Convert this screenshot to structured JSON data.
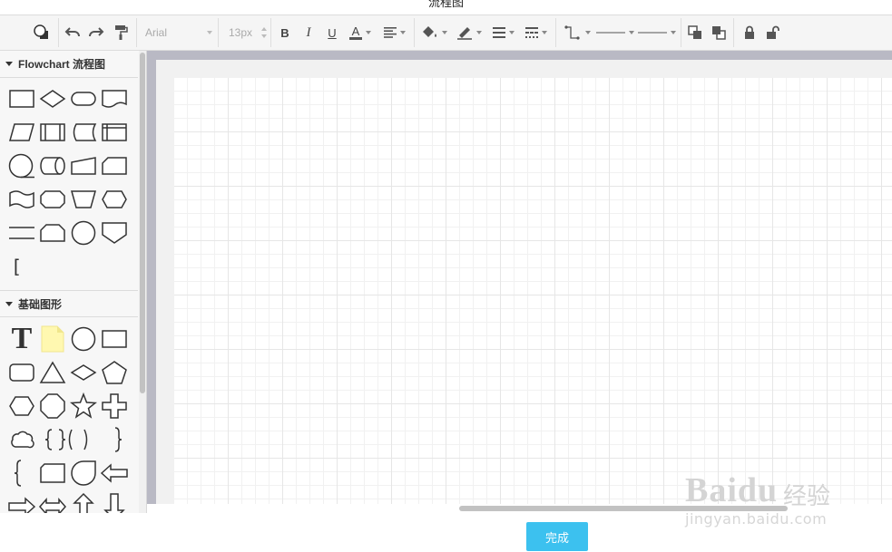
{
  "window": {
    "title": "流程图"
  },
  "toolbar": {
    "font_family": "Arial",
    "font_size": "13px",
    "bold_label": "B",
    "italic_label": "I",
    "underline_label": "U",
    "font_color_label": "A"
  },
  "sidebar": {
    "sections": [
      {
        "title": "Flowchart 流程图",
        "expanded": true
      },
      {
        "title": "基础图形",
        "expanded": true
      }
    ],
    "bracket_glyph": "[",
    "text_glyph": "T"
  },
  "footer": {
    "done_label": "完成"
  },
  "watermark": {
    "logo_text": "Baidu",
    "cn_text": "经验",
    "url_text": "jingyan.baidu.com"
  },
  "colors": {
    "accent": "#3cc1ef",
    "canvas_frame": "#b9b9c4",
    "note_fill": "#fff8b0"
  }
}
